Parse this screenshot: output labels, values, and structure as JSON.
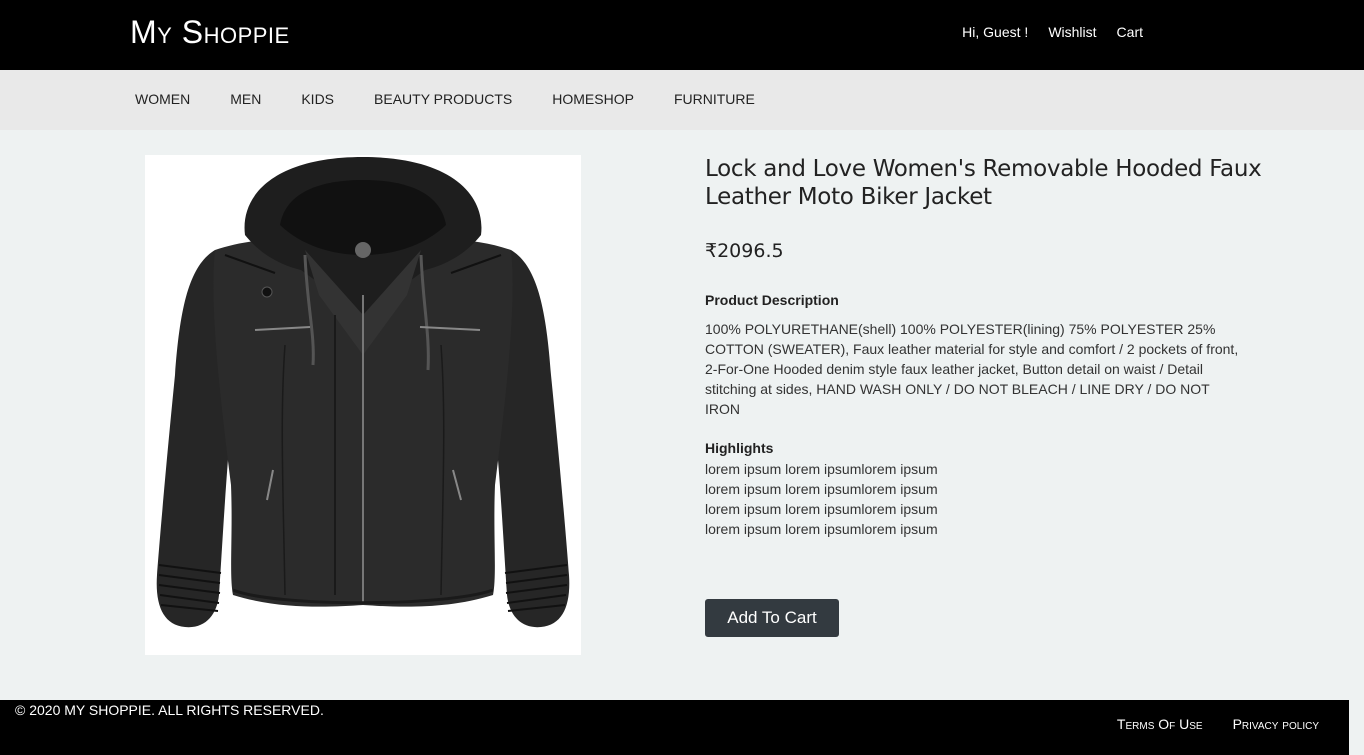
{
  "header": {
    "logo": "My Shoppie",
    "greeting": "Hi, Guest !",
    "wishlist": "Wishlist",
    "cart": "Cart"
  },
  "nav": {
    "items": [
      "WOMEN",
      "MEN",
      "KIDS",
      "BEAUTY PRODUCTS",
      "HOMESHOP",
      "FURNITURE"
    ]
  },
  "product": {
    "title": "Lock and Love Women's Removable Hooded Faux Leather Moto Biker Jacket",
    "price": "₹2096.5",
    "description_heading": "Product Description",
    "description": "100% POLYURETHANE(shell) 100% POLYESTER(lining) 75% POLYESTER 25% COTTON (SWEATER), Faux leather material for style and comfort / 2 pockets of front, 2-For-One Hooded denim style faux leather jacket, Button detail on waist / Detail stitching at sides, HAND WASH ONLY / DO NOT BLEACH / LINE DRY / DO NOT IRON",
    "highlights_heading": "Highlights",
    "highlights": [
      "lorem ipsum lorem ipsumlorem ipsum",
      "lorem ipsum lorem ipsumlorem ipsum",
      "lorem ipsum lorem ipsumlorem ipsum",
      "lorem ipsum lorem ipsumlorem ipsum"
    ],
    "add_to_cart": "Add To Cart"
  },
  "footer": {
    "copyright": "© 2020 MY SHOPPIE. ALL RIGHTS RESERVED.",
    "terms": "Terms Of Use",
    "privacy": "Privacy policy"
  }
}
